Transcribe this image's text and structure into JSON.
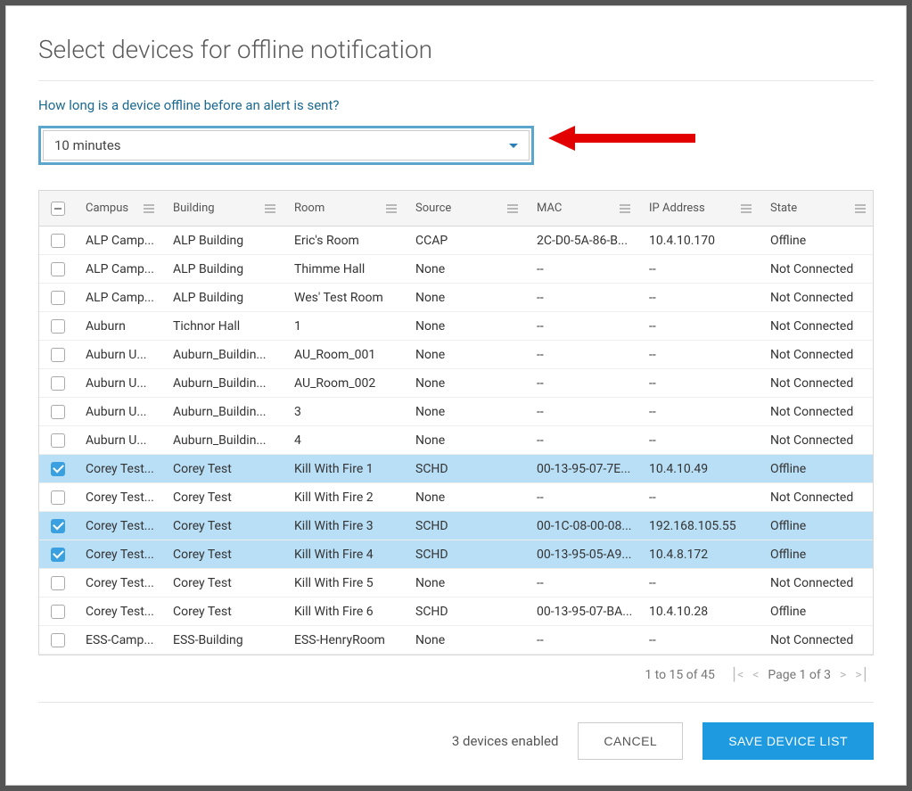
{
  "title": "Select devices for offline notification",
  "prompt": "How long is a device offline before an alert is sent?",
  "dropdown": {
    "value": "10 minutes"
  },
  "columns": [
    "Campus",
    "Building",
    "Room",
    "Source",
    "MAC",
    "IP Address",
    "State"
  ],
  "rows": [
    {
      "checked": false,
      "campus": "ALP Camp...",
      "building": "ALP Building",
      "room": "Eric's Room",
      "source": "CCAP",
      "mac": "2C-D0-5A-86-B...",
      "ip": "10.4.10.170",
      "state": "Offline"
    },
    {
      "checked": false,
      "campus": "ALP Camp...",
      "building": "ALP Building",
      "room": "Thimme Hall",
      "source": "None",
      "mac": "--",
      "ip": "--",
      "state": "Not Connected"
    },
    {
      "checked": false,
      "campus": "ALP Camp...",
      "building": "ALP Building",
      "room": "Wes' Test Room",
      "source": "None",
      "mac": "--",
      "ip": "--",
      "state": "Not Connected"
    },
    {
      "checked": false,
      "campus": "Auburn",
      "building": "Tichnor Hall",
      "room": "1",
      "source": "None",
      "mac": "--",
      "ip": "--",
      "state": "Not Connected"
    },
    {
      "checked": false,
      "campus": "Auburn U...",
      "building": "Auburn_Buildin...",
      "room": "AU_Room_001",
      "source": "None",
      "mac": "--",
      "ip": "--",
      "state": "Not Connected"
    },
    {
      "checked": false,
      "campus": "Auburn U...",
      "building": "Auburn_Buildin...",
      "room": "AU_Room_002",
      "source": "None",
      "mac": "--",
      "ip": "--",
      "state": "Not Connected"
    },
    {
      "checked": false,
      "campus": "Auburn U...",
      "building": "Auburn_Buildin...",
      "room": "3",
      "source": "None",
      "mac": "--",
      "ip": "--",
      "state": "Not Connected"
    },
    {
      "checked": false,
      "campus": "Auburn U...",
      "building": "Auburn_Buildin...",
      "room": "4",
      "source": "None",
      "mac": "--",
      "ip": "--",
      "state": "Not Connected"
    },
    {
      "checked": true,
      "campus": "Corey Test...",
      "building": "Corey Test",
      "room": "Kill With Fire 1",
      "source": "SCHD",
      "mac": "00-13-95-07-7E...",
      "ip": "10.4.10.49",
      "state": "Offline"
    },
    {
      "checked": false,
      "campus": "Corey Test...",
      "building": "Corey Test",
      "room": "Kill With Fire 2",
      "source": "None",
      "mac": "--",
      "ip": "--",
      "state": "Not Connected"
    },
    {
      "checked": true,
      "campus": "Corey Test...",
      "building": "Corey Test",
      "room": "Kill With Fire 3",
      "source": "SCHD",
      "mac": "00-1C-08-00-08...",
      "ip": "192.168.105.55",
      "state": "Offline"
    },
    {
      "checked": true,
      "campus": "Corey Test...",
      "building": "Corey Test",
      "room": "Kill With Fire 4",
      "source": "SCHD",
      "mac": "00-13-95-05-A9...",
      "ip": "10.4.8.172",
      "state": "Offline"
    },
    {
      "checked": false,
      "campus": "Corey Test...",
      "building": "Corey Test",
      "room": "Kill With Fire 5",
      "source": "None",
      "mac": "--",
      "ip": "--",
      "state": "Not Connected"
    },
    {
      "checked": false,
      "campus": "Corey Test...",
      "building": "Corey Test",
      "room": "Kill With Fire 6",
      "source": "SCHD",
      "mac": "00-13-95-07-BA...",
      "ip": "10.4.10.28",
      "state": "Offline"
    },
    {
      "checked": false,
      "campus": "ESS-Camp...",
      "building": "ESS-Building",
      "room": "ESS-HenryRoom",
      "source": "None",
      "mac": "--",
      "ip": "--",
      "state": "Not Connected"
    }
  ],
  "pager": {
    "range": "1 to 15 of 45",
    "page_label": "Page 1 of 3"
  },
  "footer": {
    "enabled_text": "3 devices enabled",
    "cancel": "CANCEL",
    "save": "SAVE DEVICE LIST"
  }
}
